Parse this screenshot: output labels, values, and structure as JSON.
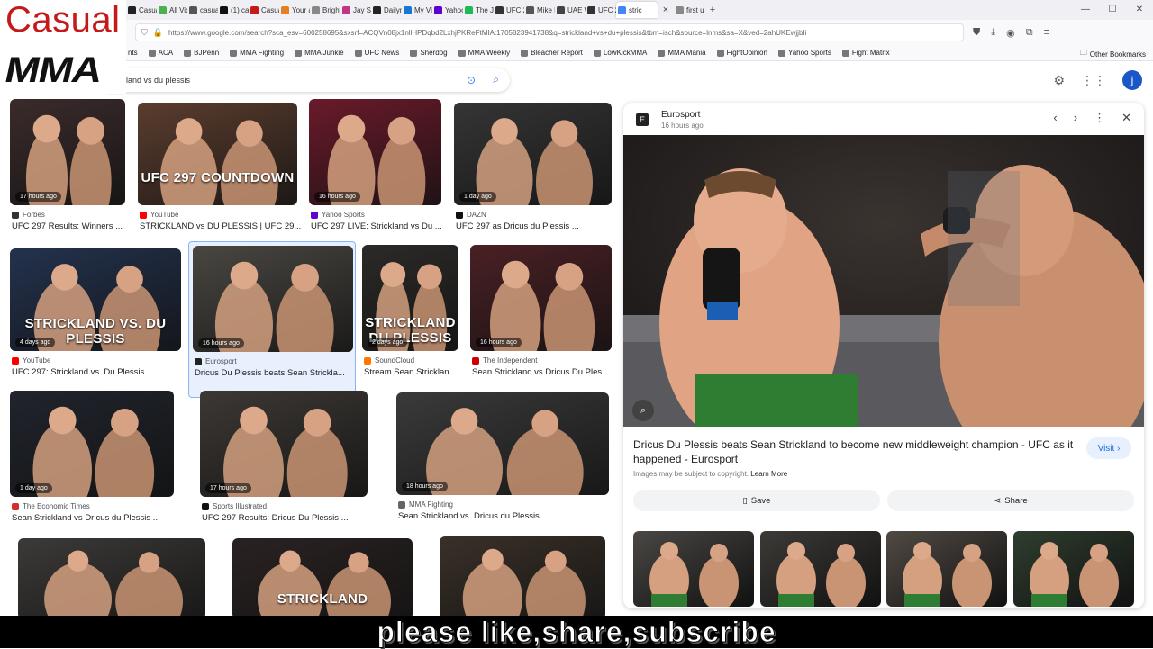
{
  "logo": {
    "line1": "Casual",
    "line2": "MMA"
  },
  "browser": {
    "tabs": [
      {
        "label": "Casual",
        "color": "#222"
      },
      {
        "label": "All Vid",
        "color": "#4caf50"
      },
      {
        "label": "casual",
        "color": "#555"
      },
      {
        "label": "(1) cas",
        "color": "#111"
      },
      {
        "label": "Casual",
        "color": "#c41a1a"
      },
      {
        "label": "Your ac",
        "color": "#e67e22"
      },
      {
        "label": "Brighte",
        "color": "#888"
      },
      {
        "label": "Jay Sle",
        "color": "#c13584"
      },
      {
        "label": "Dailym",
        "color": "#222"
      },
      {
        "label": "My Vid",
        "color": "#1976d2"
      },
      {
        "label": "Yahoo",
        "color": "#6001d2"
      },
      {
        "label": "The Jov",
        "color": "#1db954"
      },
      {
        "label": "UFC 29",
        "color": "#333"
      },
      {
        "label": "Mike M",
        "color": "#555"
      },
      {
        "label": "UAE W",
        "color": "#444"
      },
      {
        "label": "UFC 29",
        "color": "#333"
      },
      {
        "label": "stric",
        "color": "#4285f4",
        "active": true
      },
      {
        "label": "first ufc",
        "color": "#888"
      }
    ],
    "url": "https://www.google.com/search?sca_esv=600258695&sxsrf=ACQVn08jx1nllHPDqbd2LxhjPKReFtMIA:1705823941738&q=strickland+vs+du+plessis&tbm=isch&source=lnms&sa=X&ved=2ahUKEwjjbIi",
    "bookmarks": [
      "ACA",
      "BJPenn",
      "MMA Fighting",
      "MMA Junkie",
      "UFC News",
      "Sherdog",
      "MMA Weekly",
      "Bleacher Report",
      "LowKickMMA",
      "MMA Mania",
      "FightOpinion",
      "Yahoo Sports",
      "Fight Matrix"
    ],
    "other_bookmarks": "Other Bookmarks",
    "bookmark_lead": "nts"
  },
  "search": {
    "query": "land vs du plessis",
    "avatar_letter": "j"
  },
  "results": [
    {
      "age": "17 hours ago",
      "source": "Forbes",
      "title": "UFC 297 Results: Winners ...",
      "fav": "#333"
    },
    {
      "age": "",
      "source": "YouTube",
      "title": "STRICKLAND vs DU PLESSIS | UFC 29...",
      "fav": "#ff0000",
      "label": "UFC 297 COUNTDOWN"
    },
    {
      "age": "16 hours ago",
      "source": "Yahoo Sports",
      "title": "UFC 297 LIVE: Strickland vs Du ...",
      "fav": "#6001d2"
    },
    {
      "age": "1 day ago",
      "source": "DAZN",
      "title": "UFC 297 as Dricus du Plessis ...",
      "fav": "#111"
    },
    {
      "age": "4 days ago",
      "source": "YouTube",
      "title": "UFC 297: Strickland vs. Du Plessis ...",
      "fav": "#ff0000",
      "label": "STRICKLAND VS. DU PLESSIS"
    },
    {
      "age": "16 hours ago",
      "source": "Eurosport",
      "title": "Dricus Du Plessis beats Sean Strickla...",
      "fav": "#222"
    },
    {
      "age": "2 days ago",
      "source": "SoundCloud",
      "title": "Stream Sean Stricklan...",
      "fav": "#ff7700",
      "label": "STRICKLAND DU PLESSIS"
    },
    {
      "age": "16 hours ago",
      "source": "The Independent",
      "title": "Sean Strickland vs Dricus Du Ples...",
      "fav": "#c00"
    },
    {
      "age": "1 day ago",
      "source": "The Economic Times",
      "title": "Sean Strickland vs Dricus du Plessis ...",
      "fav": "#d32f2f"
    },
    {
      "age": "17 hours ago",
      "source": "Sports Illustrated",
      "title": "UFC 297 Results: Dricus Du Plessis ...",
      "fav": "#111"
    },
    {
      "age": "18 hours ago",
      "source": "MMA Fighting",
      "title": "Sean Strickland vs. Dricus du Plessis ...",
      "fav": "#666"
    },
    {
      "age": "",
      "source": "",
      "title": "",
      "fav": "#333"
    },
    {
      "age": "",
      "source": "",
      "title": "",
      "fav": "#333",
      "label": "STRICKLAND"
    },
    {
      "age": "",
      "source": "",
      "title": "",
      "fav": "#333"
    }
  ],
  "preview": {
    "source": "Eurosport",
    "age": "16 hours ago",
    "title": "Dricus Du Plessis beats Sean Strickland to become new middleweight champion - UFC as it happened - Eurosport",
    "visit": "Visit",
    "copyright": "Images may be subject to copyright.",
    "learn_more": "Learn More",
    "save": "Save",
    "share": "Share"
  },
  "banner": "please like,share,subscribe",
  "colors": {
    "accent": "#1a73e8",
    "logo_red": "#c41a1a"
  }
}
